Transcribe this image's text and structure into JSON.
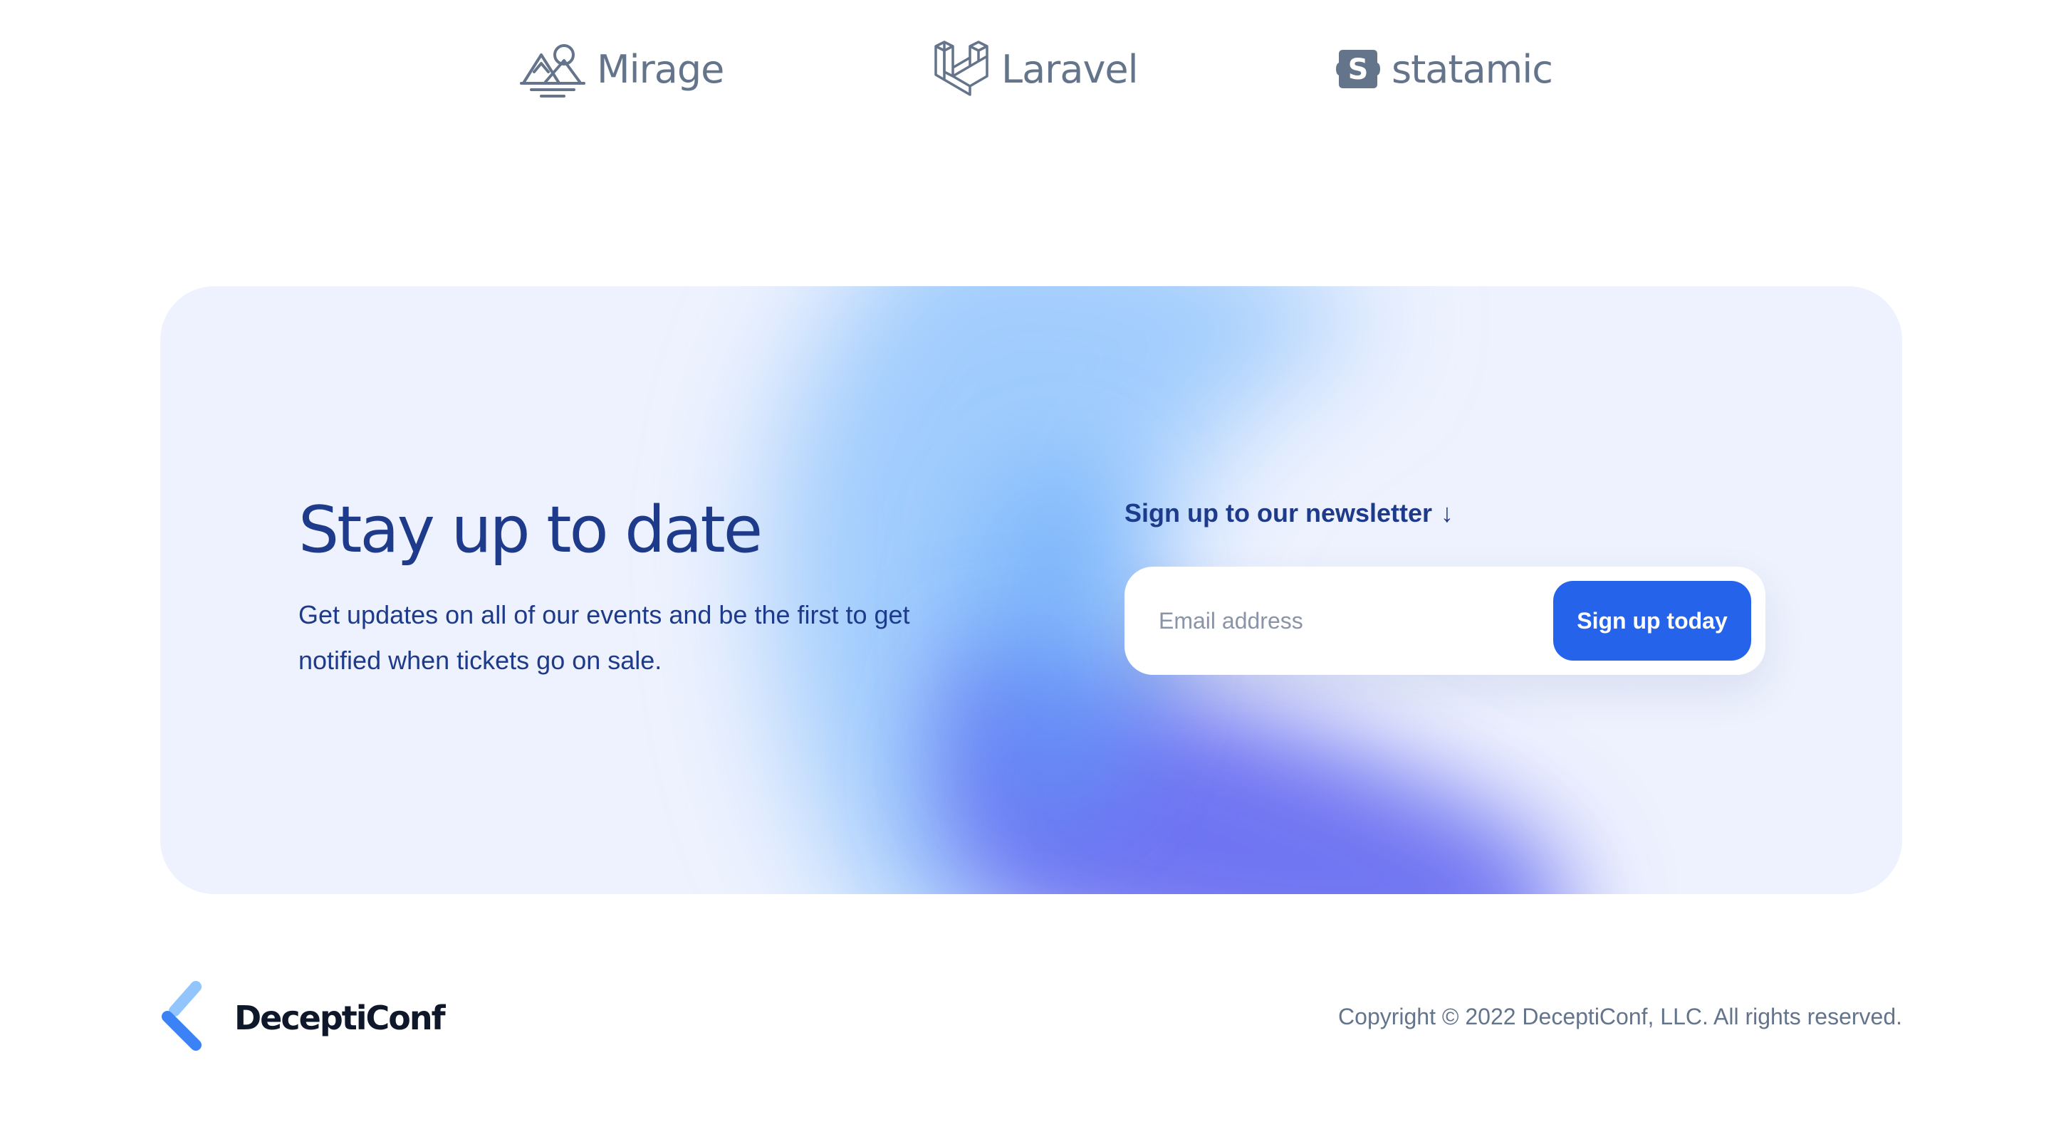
{
  "sponsors": [
    {
      "name": "Mirage",
      "icon": "mirage-mountain-icon"
    },
    {
      "name": "Laravel",
      "icon": "laravel-icon"
    },
    {
      "name": "statamic",
      "icon": "statamic-icon"
    }
  ],
  "newsletter": {
    "title": "Stay up to date",
    "description": "Get updates on all of our events and be the first to get notified when tickets go on sale.",
    "label": "Sign up to our newsletter",
    "arrow": "↓",
    "email_value": "",
    "email_placeholder": "Email address",
    "submit_label": "Sign up today"
  },
  "footer": {
    "brand": "DeceptiConf",
    "copyright": "Copyright © 2022 DeceptiConf, LLC. All rights reserved."
  },
  "colors": {
    "heading": "#1e3a8a",
    "accent": "#2563eb",
    "muted": "#64748b",
    "card_bg": "#eef2fe"
  }
}
